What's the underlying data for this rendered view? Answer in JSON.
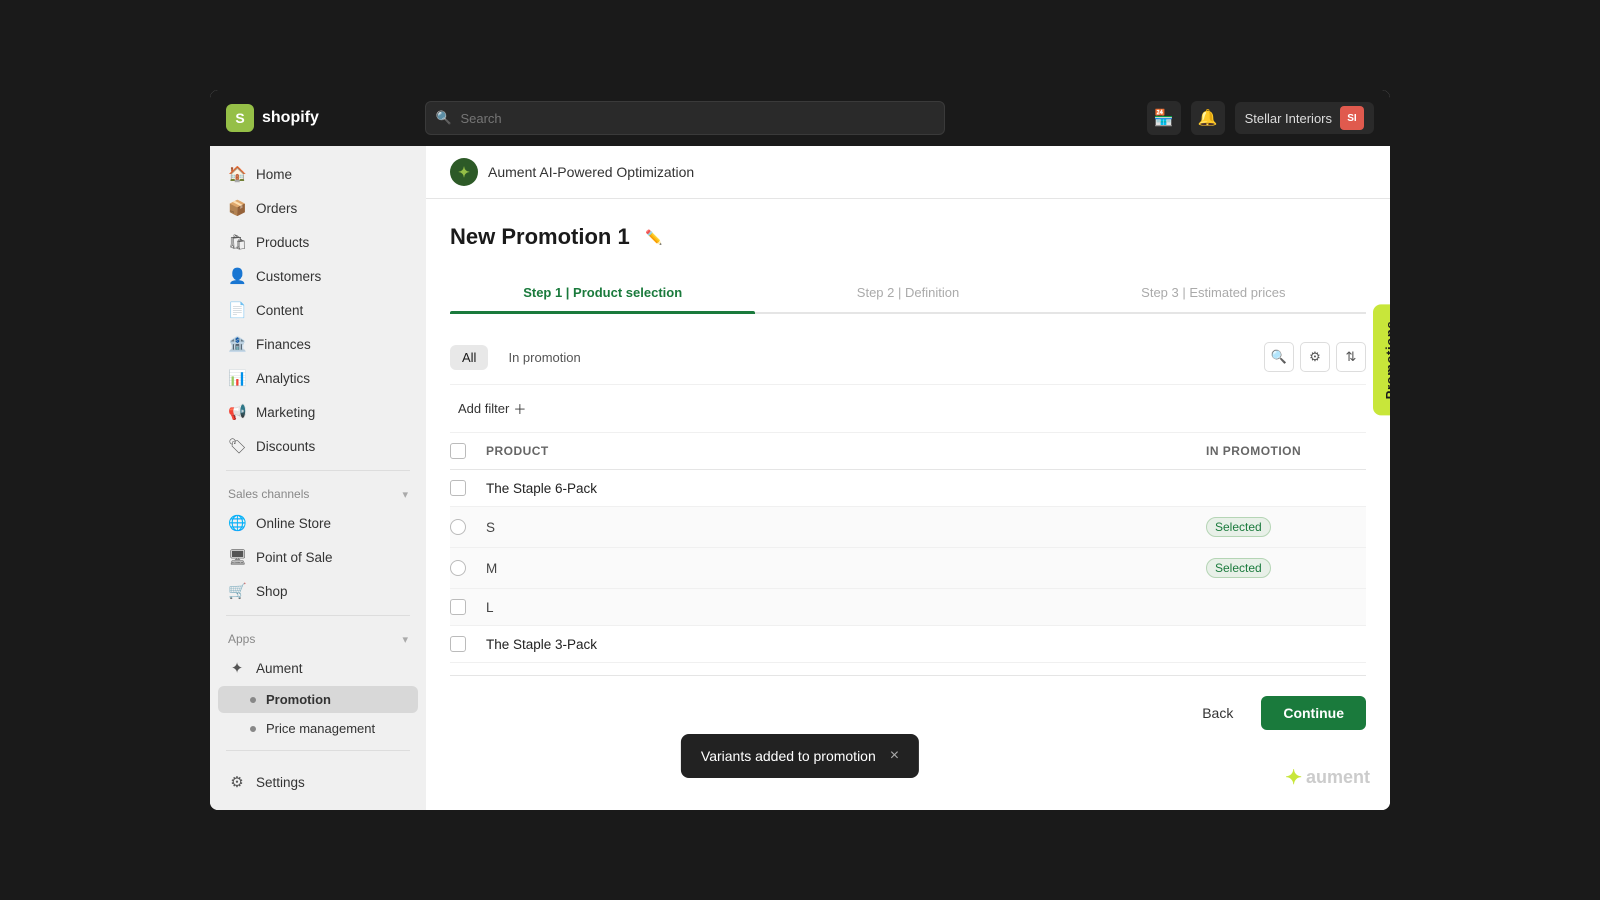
{
  "page": {
    "bg": "#1a1a1a"
  },
  "topNav": {
    "logo_text": "shopify",
    "search_placeholder": "Search",
    "user_name": "Stellar Interiors",
    "user_initials": "SI"
  },
  "sidebar": {
    "main_items": [
      {
        "id": "home",
        "label": "Home",
        "icon": "🏠"
      },
      {
        "id": "orders",
        "label": "Orders",
        "icon": "📦"
      },
      {
        "id": "products",
        "label": "Products",
        "icon": "🛍"
      },
      {
        "id": "customers",
        "label": "Customers",
        "icon": "👤"
      },
      {
        "id": "content",
        "label": "Content",
        "icon": "📄"
      },
      {
        "id": "finances",
        "label": "Finances",
        "icon": "🏦"
      },
      {
        "id": "analytics",
        "label": "Analytics",
        "icon": "📊"
      },
      {
        "id": "marketing",
        "label": "Marketing",
        "icon": "📢"
      },
      {
        "id": "discounts",
        "label": "Discounts",
        "icon": "🏷"
      }
    ],
    "sales_channels_label": "Sales channels",
    "sales_channels": [
      {
        "id": "online-store",
        "label": "Online Store",
        "icon": "🌐"
      },
      {
        "id": "pos",
        "label": "Point of Sale",
        "icon": "🖥"
      },
      {
        "id": "shop",
        "label": "Shop",
        "icon": "🛒"
      }
    ],
    "apps_label": "Apps",
    "apps": [
      {
        "id": "aument",
        "label": "Aument",
        "icon": "✦"
      },
      {
        "id": "promotion",
        "label": "Promotion",
        "icon": ""
      },
      {
        "id": "price-management",
        "label": "Price management",
        "icon": ""
      }
    ],
    "settings_label": "Settings",
    "settings_icon": "⚙"
  },
  "appHeader": {
    "icon": "✦",
    "title": "Aument AI-Powered Optimization"
  },
  "page_title": "New Promotion 1",
  "steps": [
    {
      "id": "step1",
      "label": "Step 1 | Product selection",
      "active": true
    },
    {
      "id": "step2",
      "label": "Step 2 | Definition",
      "active": false
    },
    {
      "id": "step3",
      "label": "Step 3 | Estimated prices",
      "active": false
    }
  ],
  "tabs": {
    "all": "All",
    "in_promotion": "In promotion"
  },
  "table": {
    "col_product": "Product",
    "col_in_promotion": "In promotion",
    "rows": [
      {
        "id": "staple6",
        "name": "The Staple 6-Pack",
        "type": "product",
        "in_promotion": "",
        "selected": false
      },
      {
        "id": "staple6-s",
        "name": "S",
        "type": "variant",
        "in_promotion": "Selected",
        "selected": true
      },
      {
        "id": "staple6-m",
        "name": "M",
        "type": "variant",
        "in_promotion": "Selected",
        "selected": true
      },
      {
        "id": "staple6-l",
        "name": "L",
        "type": "variant",
        "in_promotion": "",
        "selected": false
      },
      {
        "id": "staple3",
        "name": "The Staple 3-Pack",
        "type": "product",
        "in_promotion": "",
        "selected": false
      }
    ]
  },
  "add_filter": "Add filter",
  "buttons": {
    "back": "Back",
    "continue": "Continue"
  },
  "toast": {
    "message": "Variants added to promotion",
    "close": "×"
  },
  "side_tab": "Promotions",
  "aument_logo": "✦ aument"
}
